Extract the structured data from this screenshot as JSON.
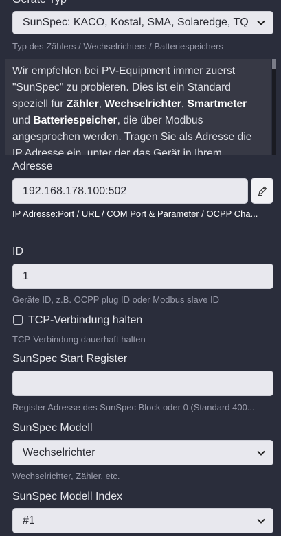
{
  "geraete_typ": {
    "label": "Geräte Typ",
    "value": "SunSpec: KACO, Kostal, SMA, Solaredge, TQ-Sy",
    "hint": "Typ des Zählers / Wechselrichters / Batteriespeichers"
  },
  "info": {
    "p1": "Wir empfehlen bei PV-Equipment immer zuerst \"SunSpec\" zu probieren. Dies ist ein Standard speziell für ",
    "b1": "Zähler",
    "p2": ", ",
    "b2": "Wechselrichter",
    "p3": ", ",
    "b3": "Smartmeter",
    "p4": " und ",
    "b4": "Batteriespeicher",
    "p5": ", die über Modbus angesprochen werden. Tragen Sie als Adresse die IP Adresse ein, unter der das Gerät in Ihrem Heimnetz eingebucht"
  },
  "adresse": {
    "label": "Adresse",
    "value": "192.168.178.100:502",
    "hint": "IP Adresse:Port / URL / COM Port & Parameter / OCPP Cha..."
  },
  "id_field": {
    "label": "ID",
    "value": "1",
    "hint": "Geräte ID, z.B. OCPP plug ID oder Modbus slave ID"
  },
  "tcp": {
    "label": "TCP-Verbindung halten",
    "hint": "TCP-Verbindung dauerhaft halten",
    "checked": false
  },
  "start_register": {
    "label": "SunSpec Start Register",
    "value": "",
    "hint": "Register Adresse des SunSpec Block oder 0 (Standard 400..."
  },
  "modell": {
    "label": "SunSpec Modell",
    "value": "Wechselrichter",
    "hint": "Wechselrichter, Zähler, etc."
  },
  "modell_index": {
    "label": "SunSpec Modell Index",
    "value": "#1"
  }
}
